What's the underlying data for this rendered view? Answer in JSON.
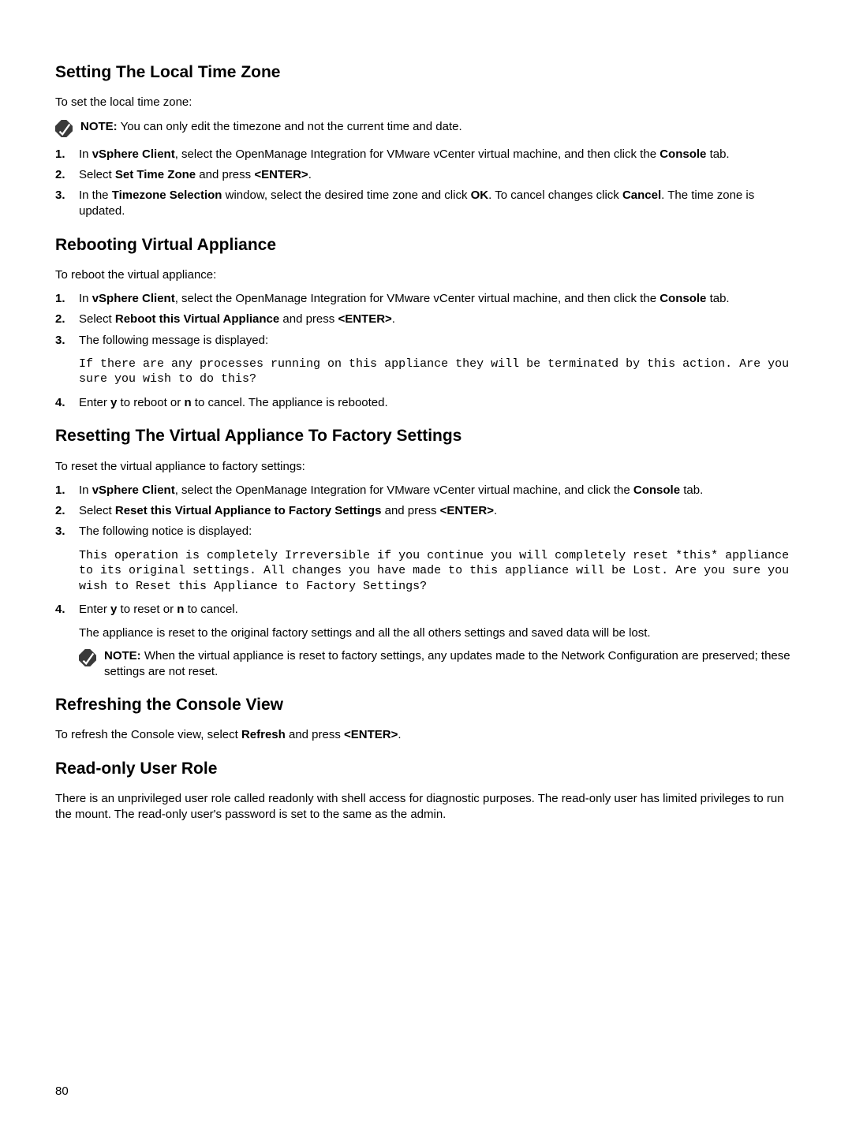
{
  "section1": {
    "heading": "Setting The Local Time Zone",
    "intro": "To set the local time zone:",
    "note_label": "NOTE:",
    "note_text": " You can only edit the timezone and not the current time and date.",
    "steps": [
      {
        "n": "1.",
        "pre": "In ",
        "b1": "vSphere Client",
        "mid": ", select the OpenManage Integration for VMware vCenter virtual machine, and then click the ",
        "b2": "Console",
        "post": " tab."
      },
      {
        "n": "2.",
        "pre": "Select ",
        "b1": "Set Time Zone",
        "mid": " and press ",
        "b2": "<ENTER>",
        "post": "."
      },
      {
        "n": "3.",
        "pre": "In the ",
        "b1": "Timezone Selection",
        "mid": " window, select the desired time zone and click ",
        "b2": "OK",
        "post1": ". To cancel changes click ",
        "b3": "Cancel",
        "post2": ". The time zone is updated."
      }
    ]
  },
  "section2": {
    "heading": "Rebooting Virtual Appliance",
    "intro": "To reboot the virtual appliance:",
    "steps": {
      "s1": {
        "n": "1.",
        "pre": "In ",
        "b1": "vSphere Client",
        "mid": ", select the OpenManage Integration for VMware vCenter virtual machine, and then click the ",
        "b2": "Console",
        "post": " tab."
      },
      "s2": {
        "n": "2.",
        "pre": "Select ",
        "b1": "Reboot this Virtual Appliance",
        "mid": " and press ",
        "b2": "<ENTER>",
        "post": "."
      },
      "s3": {
        "n": "3.",
        "text": "The following message is displayed:"
      },
      "s4": {
        "n": "4.",
        "pre": "Enter ",
        "b1": "y",
        "mid": " to reboot or ",
        "b2": "n",
        "post": " to cancel. The appliance is rebooted."
      }
    },
    "code": "If there are any processes running on this appliance they will be terminated by this action. Are you sure you wish to do this?"
  },
  "section3": {
    "heading": "Resetting The Virtual Appliance To Factory Settings",
    "intro": "To reset the virtual appliance to factory settings:",
    "steps": {
      "s1": {
        "n": "1.",
        "pre": "In ",
        "b1": "vSphere Client",
        "mid": ", select the OpenManage Integration for VMware vCenter virtual machine, and click the ",
        "b2": "Console",
        "post": " tab."
      },
      "s2": {
        "n": "2.",
        "pre": "Select ",
        "b1": "Reset this Virtual Appliance to Factory Settings",
        "mid": " and press ",
        "b2": "<ENTER>",
        "post": "."
      },
      "s3": {
        "n": "3.",
        "text": "The following notice is displayed:"
      },
      "s4": {
        "n": "4.",
        "pre": "Enter ",
        "b1": "y",
        "mid": " to reset or ",
        "b2": "n",
        "post": " to cancel."
      }
    },
    "code": "This operation is completely Irreversible if you continue you will completely reset *this* appliance to its original settings. All changes you have made to this appliance will be Lost. Are you sure you wish to Reset this Appliance to Factory Settings?",
    "subpara": "The appliance is reset to the original factory settings and all the all others settings and saved data will be lost.",
    "note_label": "NOTE:",
    "note_text": " When the virtual appliance is reset to factory settings, any updates made to the Network Configuration are preserved; these settings are not reset."
  },
  "section4": {
    "heading": "Refreshing the Console View",
    "p_pre": "To refresh the Console view, select ",
    "p_b1": "Refresh",
    "p_mid": " and press ",
    "p_b2": "<ENTER>",
    "p_post": "."
  },
  "section5": {
    "heading": "Read-only User Role",
    "para": "There is an unprivileged user role called readonly with shell access for diagnostic purposes. The read-only user has limited privileges to run the mount. The read-only user's password is set to the same as the admin."
  },
  "page_number": "80"
}
